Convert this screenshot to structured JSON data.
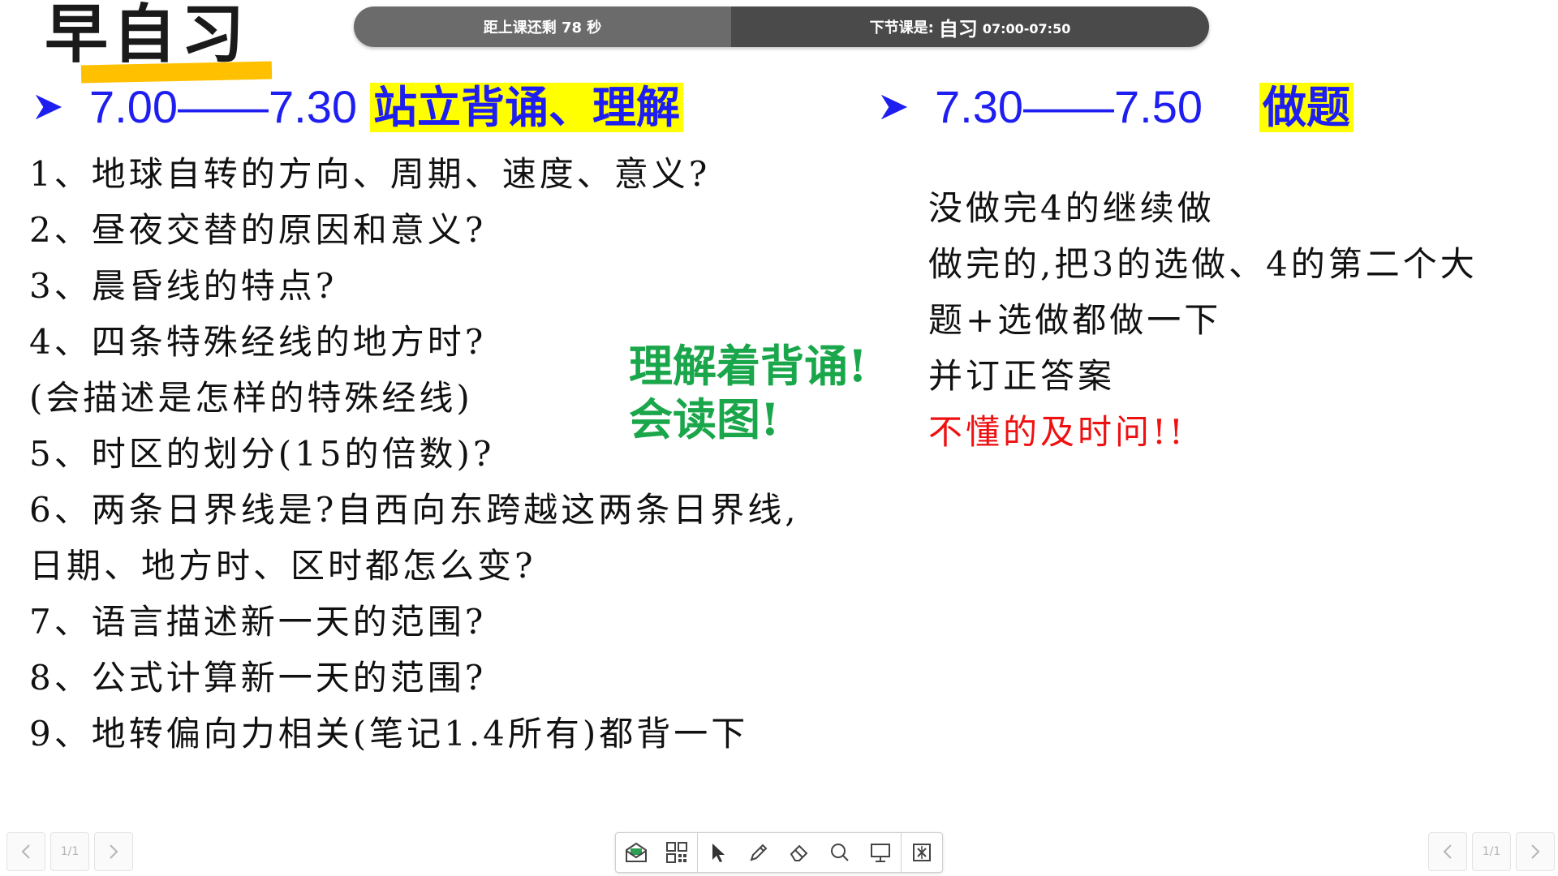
{
  "slide": {
    "title": "早自习",
    "colors": {
      "title_underline": "#ffc000",
      "time_blue": "#1e1ef0",
      "highlight_yellow": "#ffff00",
      "note_green": "#1aa64a",
      "alert_red": "#ee1111"
    },
    "left_section": {
      "time_range": "7.00——7.30",
      "activity": "站立背诵、理解",
      "items": [
        "1、地球自转的方向、周期、速度、意义?",
        "2、昼夜交替的原因和意义?",
        "3、晨昏线的特点?",
        "4、四条特殊经线的地方时?",
        "(会描述是怎样的特殊经线)",
        "5、时区的划分(15的倍数)?",
        "6、两条日界线是?自西向东跨越这两条日界线,",
        "日期、地方时、区时都怎么变?",
        "7、语言描述新一天的范围?",
        "8、公式计算新一天的范围?",
        "9、地转偏向力相关(笔记1.4所有)都背一下"
      ]
    },
    "center_note": {
      "line1": "理解着背诵!",
      "line2": "会读图!"
    },
    "right_section": {
      "time_range": "7.30——7.50",
      "activity": "做题",
      "lines": [
        "没做完4的继续做",
        "做完的,把3的选做、4的第二个大",
        "题+选做都做一下",
        "并订正答案"
      ],
      "alert": "不懂的及时问!!"
    }
  },
  "timer": {
    "countdown": "距上课还剩 78 秒",
    "next_label": "下节课是:",
    "next_name": "自习",
    "next_time": "07:00-07:50"
  },
  "pager_left": {
    "prev": "previous-icon",
    "page": "1/1",
    "next": "next-icon"
  },
  "pager_right": {
    "prev": "previous-icon",
    "page": "1/1",
    "next": "next-icon"
  },
  "toolbar": {
    "icons": [
      "envelope-icon",
      "qr-grid-icon",
      "pointer-icon",
      "pen-icon",
      "eraser-icon",
      "search-icon",
      "screen-icon",
      "exit-icon"
    ]
  }
}
